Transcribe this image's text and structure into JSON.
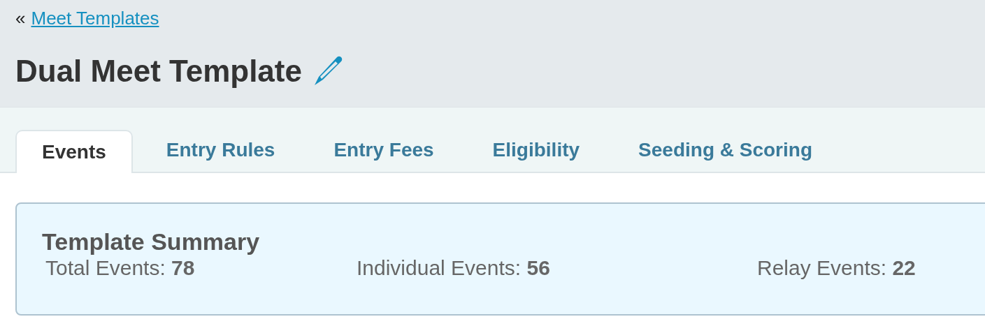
{
  "breadcrumb": {
    "prefix": "«",
    "link": "Meet Templates"
  },
  "title": "Dual Meet Template",
  "tabs": [
    {
      "label": "Events",
      "selected": true
    },
    {
      "label": "Entry Rules",
      "selected": false
    },
    {
      "label": "Entry Fees",
      "selected": false
    },
    {
      "label": "Eligibility",
      "selected": false
    },
    {
      "label": "Seeding & Scoring",
      "selected": false
    }
  ],
  "summary": {
    "title": "Template Summary",
    "stats": [
      "Total Events: **78**",
      "Individual Events: **56**",
      "Relay Events: **22**"
    ]
  }
}
